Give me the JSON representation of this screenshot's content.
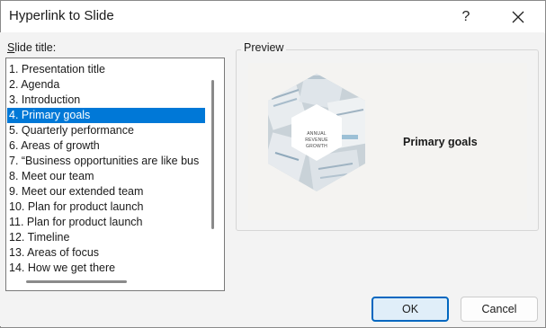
{
  "dialog": {
    "title": "Hyperlink to Slide",
    "help_glyph": "?",
    "close_glyph": "✕"
  },
  "list": {
    "label_accel": "S",
    "label_rest": "lide title:",
    "selected_index": 3,
    "items": [
      "1. Presentation title",
      "2. Agenda",
      "3. Introduction",
      "4. Primary goals",
      "5. Quarterly performance",
      "6. Areas of growth",
      "7. “Business opportunities are like bus",
      "8. Meet our team",
      "9. Meet our extended team",
      "10. Plan for product launch",
      "11. Plan for product launch",
      "12. Timeline",
      "13. Areas of focus",
      "14. How we get there"
    ]
  },
  "preview": {
    "label": "Preview",
    "slide_title": "Primary goals",
    "hex_text": "ANNUAL\nREVENUE\nGROWTH"
  },
  "buttons": {
    "ok": "OK",
    "cancel": "Cancel"
  },
  "colors": {
    "selection": "#0078d7",
    "ok_border": "#0067c0",
    "ok_fill": "#e0eef9"
  }
}
